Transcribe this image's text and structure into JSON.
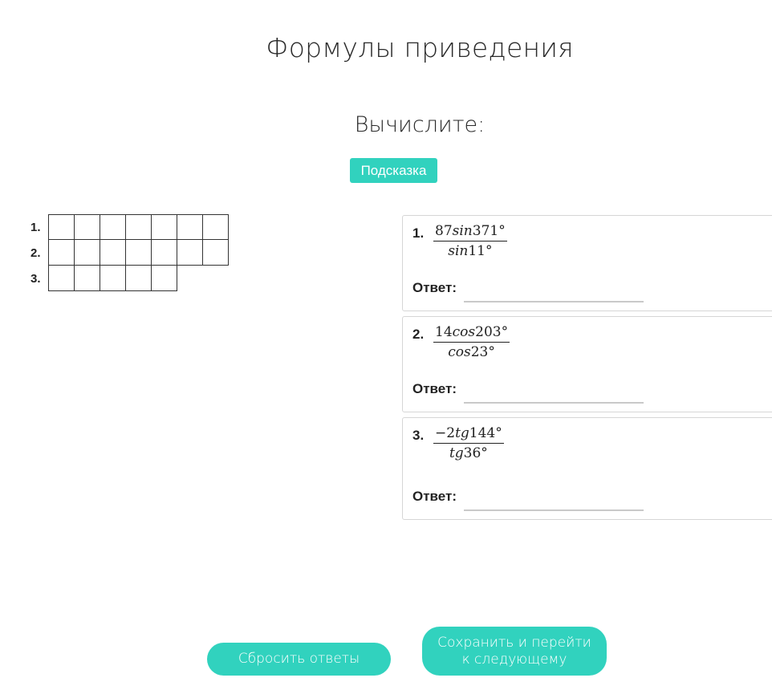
{
  "page": {
    "title": "Формулы приведения"
  },
  "task": {
    "title": "Вычислите:",
    "hint_label": "Подсказка"
  },
  "answer_grid": {
    "rows": [
      {
        "label": "1.",
        "cells": 7
      },
      {
        "label": "2.",
        "cells": 7
      },
      {
        "label": "3.",
        "cells": 5
      }
    ]
  },
  "problems": [
    {
      "number": "1.",
      "numerator_coef": "87",
      "numerator_fn": "sin",
      "numerator_angle": "371°",
      "denominator_fn": "sin",
      "denominator_angle": "11°",
      "answer_label": "Ответ:",
      "answer_value": ""
    },
    {
      "number": "2.",
      "numerator_coef": "14",
      "numerator_fn": "cos",
      "numerator_angle": "203°",
      "denominator_fn": "cos",
      "denominator_angle": "23°",
      "answer_label": "Ответ:",
      "answer_value": ""
    },
    {
      "number": "3.",
      "numerator_coef": "−2",
      "numerator_fn": "tg",
      "numerator_angle": "144°",
      "denominator_fn": "tg",
      "denominator_angle": "36°",
      "answer_label": "Ответ:",
      "answer_value": ""
    }
  ],
  "actions": {
    "reset_label": "Сбросить ответы",
    "save_label": "Сохранить и перейти к следующему"
  },
  "colors": {
    "accent": "#31d2be",
    "card_border": "#d6d6d6"
  }
}
